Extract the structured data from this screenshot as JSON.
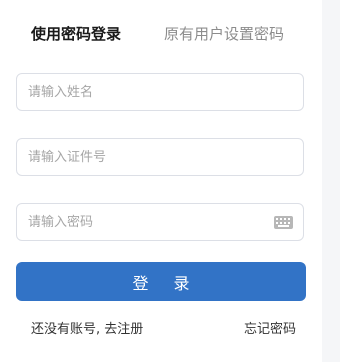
{
  "tabs": {
    "active_label": "使用密码登录",
    "inactive_label": "原有用户设置密码"
  },
  "form": {
    "name_placeholder": "请输入姓名",
    "id_placeholder": "请输入证件号",
    "password_placeholder": "请输入密码",
    "keyboard_icon": "keyboard-icon"
  },
  "actions": {
    "login_label": "登 录",
    "register_link": "还没有账号, 去注册",
    "forgot_link": "忘记密码"
  },
  "colors": {
    "primary": "#3273c6",
    "border": "#dcdfe6",
    "placeholder": "#a6a6a6"
  }
}
